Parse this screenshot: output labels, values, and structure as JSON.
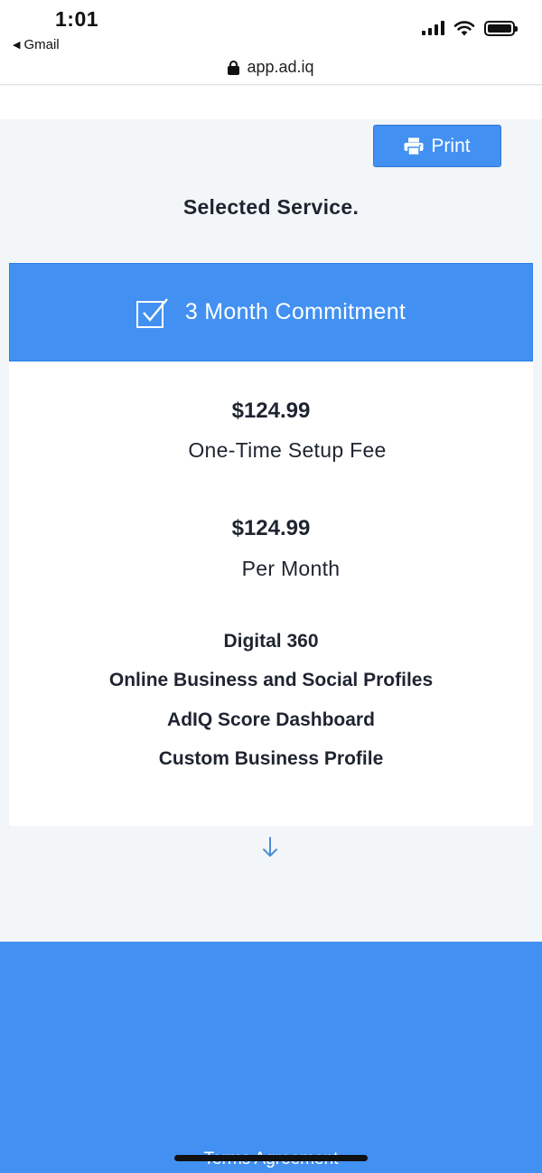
{
  "status_bar": {
    "time": "1:01",
    "back_app": "Gmail"
  },
  "browser": {
    "url": "app.ad.iq"
  },
  "toolbar": {
    "print_label": "Print"
  },
  "page": {
    "title": "Selected Service."
  },
  "plan": {
    "name": "3 Month Commitment",
    "setup_price": "$124.99",
    "setup_label": "One-Time Setup Fee",
    "monthly_price": "$124.99",
    "monthly_label": "Per Month",
    "features": [
      "Digital 360",
      "Online Business and Social Profiles",
      "AdIQ Score Dashboard",
      "Custom Business Profile"
    ]
  },
  "footer": {
    "terms_label": "Terms Agreement"
  },
  "colors": {
    "accent": "#4290f2",
    "background": "#f3f6f9",
    "text": "#1e2430"
  }
}
